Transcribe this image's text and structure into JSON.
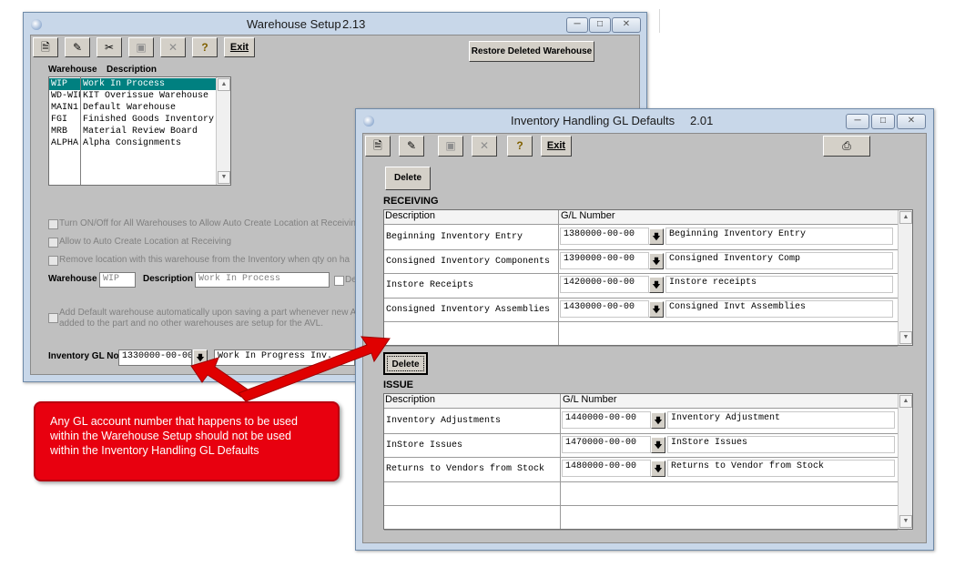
{
  "colors": {
    "highlight": "#008080",
    "callout": "#e8000f",
    "arrow": "#e00000",
    "titlebar": "#c8d7e9",
    "window_body": "#c0c0c0"
  },
  "icons": [
    "app-icon",
    "new-icon",
    "edit-icon",
    "cut-icon",
    "save-icon",
    "delete-icon",
    "help-icon",
    "print-icon"
  ],
  "warehouse_window": {
    "title": "Warehouse Setup",
    "version": "2.13",
    "toolbar": {
      "exit_label": "Exit"
    },
    "restore_label": "Restore Deleted Warehouse",
    "list_headers": {
      "warehouse": "Warehouse",
      "description": "Description"
    },
    "list": [
      {
        "code": "WIP",
        "description": "Work In Process"
      },
      {
        "code": "WD-WIP",
        "description": "KIT Overissue Warehouse"
      },
      {
        "code": "MAIN1",
        "description": "Default Warehouse"
      },
      {
        "code": "FGI",
        "description": "Finished Goods Inventory"
      },
      {
        "code": "MRB",
        "description": "Material Review Board"
      },
      {
        "code": "ALPHA",
        "description": "Alpha Consignments"
      }
    ],
    "options": {
      "turn_on_off": "Turn ON/Off for All Warehouses to Allow Auto Create Location at Receiving",
      "allow_auto": "Allow to Auto Create Location at Receiving",
      "remove_location": "Remove location with this warehouse from the Inventory when qty on ha",
      "add_default_line1": "Add Default warehouse automatically upon saving a part whenever new A",
      "add_default_line2": "added to the part and no other warehouses are setup for the AVL."
    },
    "form": {
      "warehouse_label": "Warehouse",
      "warehouse_value": "WIP",
      "description_label": "Description",
      "description_value": "Work In Process",
      "de_label": "De",
      "gl_label": "Inventory GL No",
      "gl_value": "1330000-00-00",
      "gl_description": "Work In Progress Inv."
    }
  },
  "inventory_window": {
    "title": "Inventory Handling GL Defaults",
    "version": "2.01",
    "toolbar": {
      "exit_label": "Exit"
    },
    "delete_label": "Delete",
    "receiving": {
      "heading": "RECEIVING",
      "headers": {
        "description": "Description",
        "gl": "G/L Number"
      },
      "rows": [
        {
          "description": "Beginning Inventory Entry",
          "gl": "1380000-00-00",
          "gl_desc": "Beginning Inventory Entry"
        },
        {
          "description": "Consigned Inventory Components",
          "gl": "1390000-00-00",
          "gl_desc": "Consigned Inventory Comp"
        },
        {
          "description": "Instore Receipts",
          "gl": "1420000-00-00",
          "gl_desc": "Instore receipts"
        },
        {
          "description": "Consigned Inventory Assemblies",
          "gl": "1430000-00-00",
          "gl_desc": "Consigned Invt Assemblies"
        }
      ]
    },
    "issue": {
      "heading": "ISSUE",
      "headers": {
        "description": "Description",
        "gl": "G/L Number"
      },
      "rows": [
        {
          "description": "Inventory Adjustments",
          "gl": "1440000-00-00",
          "gl_desc": "Inventory Adjustment"
        },
        {
          "description": "InStore Issues",
          "gl": "1470000-00-00",
          "gl_desc": "InStore Issues"
        },
        {
          "description": "Returns to Vendors from Stock",
          "gl": "1480000-00-00",
          "gl_desc": "Returns to Vendor from Stock"
        }
      ]
    }
  },
  "callout": {
    "text": "Any GL account number that happens to be used within the Warehouse Setup should not be used within the Inventory Handling GL Defaults"
  }
}
